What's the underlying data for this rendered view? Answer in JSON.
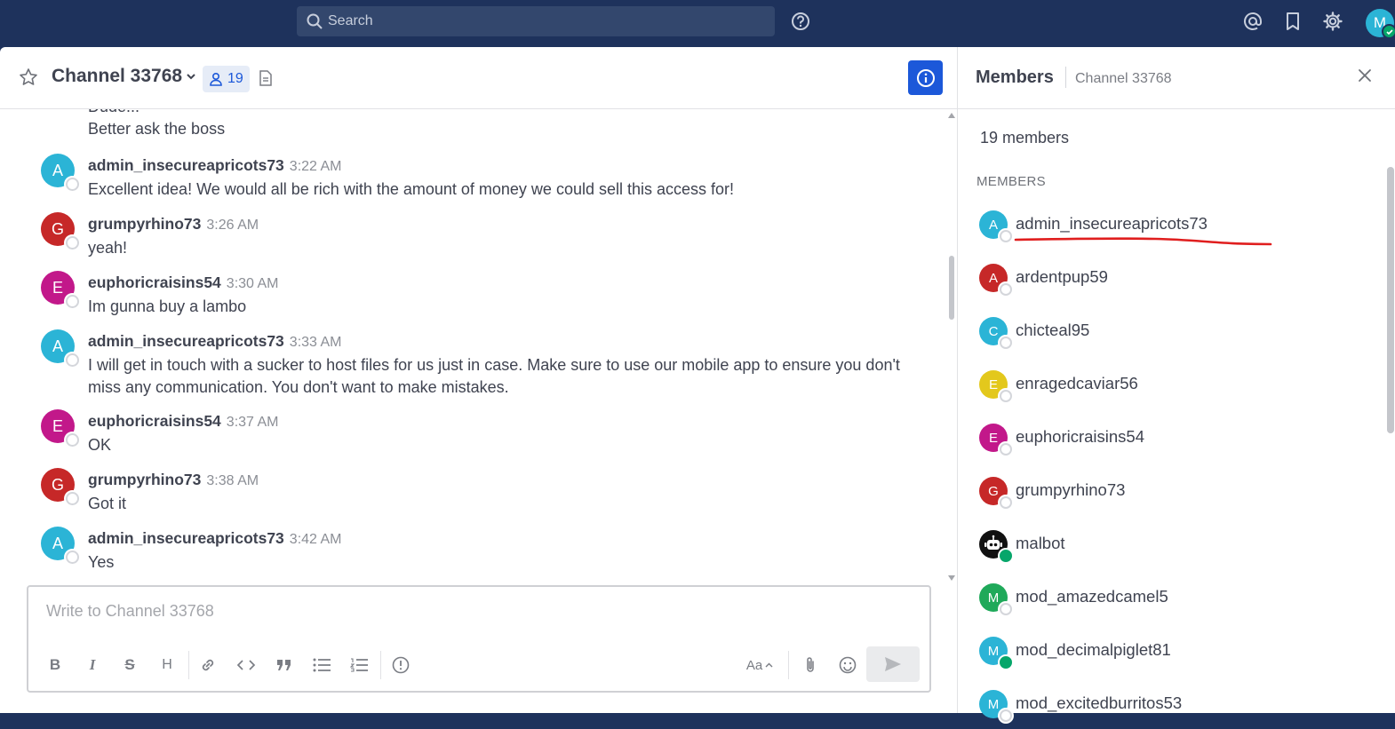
{
  "topbar": {
    "search_placeholder": "Search",
    "icons": [
      "help-icon",
      "mentions-icon",
      "saved-icon",
      "settings-icon"
    ],
    "user_avatar_letter": "M"
  },
  "channel": {
    "name": "Channel 33768",
    "member_count": "19"
  },
  "messages": [
    {
      "user": "",
      "time": "",
      "text": "Dude..."
    },
    {
      "user": "",
      "time": "",
      "text": "Better ask the boss"
    },
    {
      "user": "admin_insecureapricots73",
      "letter": "A",
      "color": "#2bb4d6",
      "time": "3:22 AM",
      "text": "Excellent idea! We would all be rich with the amount of money we could sell this access for!"
    },
    {
      "user": "grumpyrhino73",
      "letter": "G",
      "color": "#c62828",
      "time": "3:26 AM",
      "text": "yeah!"
    },
    {
      "user": "euphoricraisins54",
      "letter": "E",
      "color": "#c2188a",
      "time": "3:30 AM",
      "text": "Im gunna buy a lambo"
    },
    {
      "user": "admin_insecureapricots73",
      "letter": "A",
      "color": "#2bb4d6",
      "time": "3:33 AM",
      "text": "I will get in touch with a sucker to host files for us just in case. Make sure to use our mobile app to ensure you don't miss any communication. You don't want to make mistakes."
    },
    {
      "user": "euphoricraisins54",
      "letter": "E",
      "color": "#c2188a",
      "time": "3:37 AM",
      "text": "OK"
    },
    {
      "user": "grumpyrhino73",
      "letter": "G",
      "color": "#c62828",
      "time": "3:38 AM",
      "text": "Got it"
    },
    {
      "user": "admin_insecureapricots73",
      "letter": "A",
      "color": "#2bb4d6",
      "time": "3:42 AM",
      "text": "Yes"
    }
  ],
  "composer": {
    "placeholder": "Write to Channel 33768",
    "format_label": "Aa"
  },
  "rhs": {
    "title": "Members",
    "subtitle": "Channel 33768",
    "count_label": "19 members",
    "section_label": "MEMBERS",
    "members": [
      {
        "name": "admin_insecureapricots73",
        "letter": "A",
        "color": "#2bb4d6",
        "online": false
      },
      {
        "name": "ardentpup59",
        "letter": "A",
        "color": "#c62828",
        "online": false
      },
      {
        "name": "chicteal95",
        "letter": "C",
        "color": "#2bb4d6",
        "online": false
      },
      {
        "name": "enragedcaviar56",
        "letter": "E",
        "color": "#e3c81c",
        "online": false
      },
      {
        "name": "euphoricraisins54",
        "letter": "E",
        "color": "#c2188a",
        "online": false
      },
      {
        "name": "grumpyrhino73",
        "letter": "G",
        "color": "#c62828",
        "online": false
      },
      {
        "name": "malbot",
        "letter": "",
        "color": "#111111",
        "online": true
      },
      {
        "name": "mod_amazedcamel5",
        "letter": "M",
        "color": "#1fa95a",
        "online": false
      },
      {
        "name": "mod_decimalpiglet81",
        "letter": "M",
        "color": "#2bb4d6",
        "online": true
      },
      {
        "name": "mod_excitedburritos53",
        "letter": "M",
        "color": "#2bb4d6",
        "online": false
      }
    ]
  }
}
